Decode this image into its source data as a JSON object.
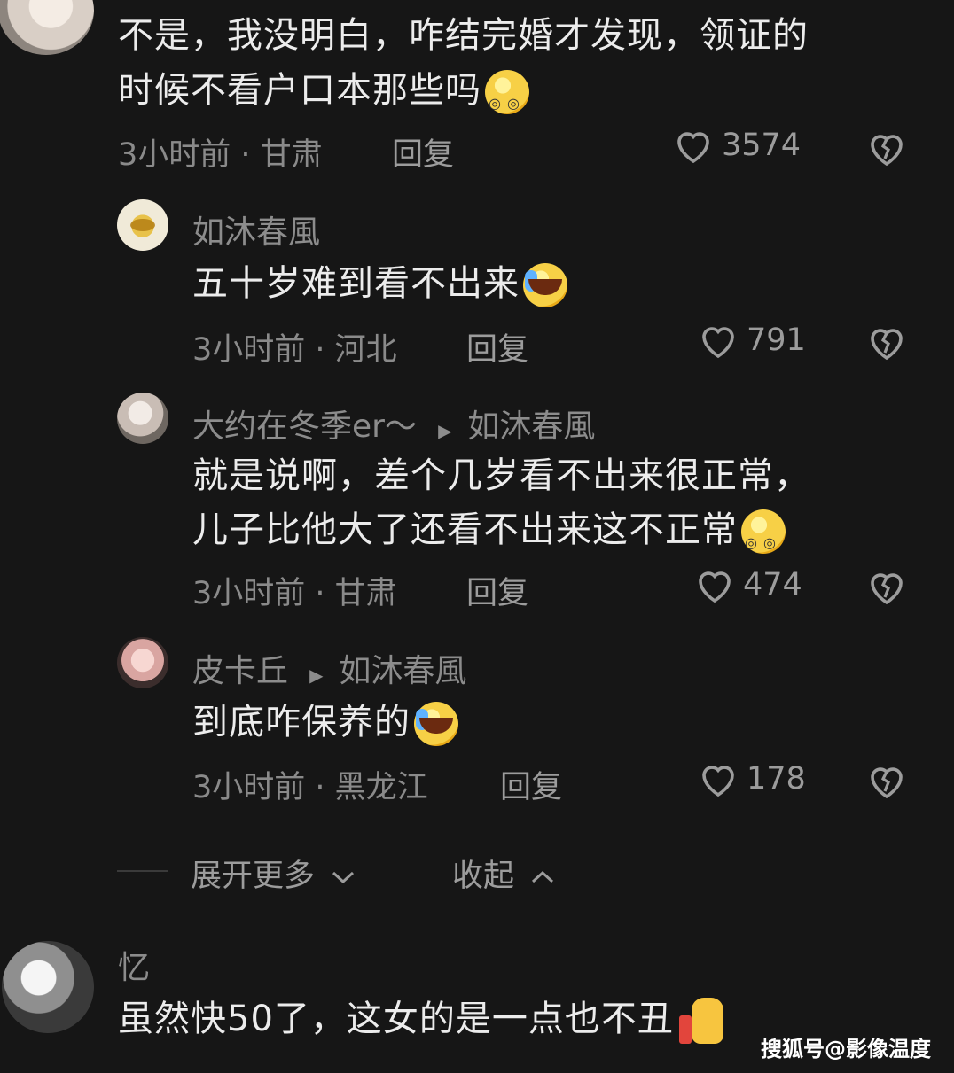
{
  "comment1": {
    "text_line1": "不是，我没明白，咋结完婚才发现，领证的",
    "text_line2": "时候不看户口本那些吗",
    "meta": "3小时前 · 甘肃",
    "reply": "回复",
    "likes": "3574",
    "emoji": "dizzy-face-emoji"
  },
  "reply1": {
    "username": "如沐春風",
    "text": "五十岁难到看不出来",
    "meta": "3小时前 · 河北",
    "reply": "回复",
    "likes": "791",
    "emoji": "laughing-crying-emoji"
  },
  "reply2": {
    "username": "大约在冬季er～",
    "reply_to": "如沐春風",
    "text_line1": "就是说啊，差个几岁看不出来很正常，",
    "text_line2": "儿子比他大了还看不出来这不正常",
    "meta": "3小时前 · 甘肃",
    "reply": "回复",
    "likes": "474",
    "emoji": "dizzy-face-emoji"
  },
  "reply3": {
    "username": "皮卡丘",
    "reply_to": "如沐春風",
    "text": "到底咋保养的",
    "meta": "3小时前 · 黑龙江",
    "reply": "回复",
    "likes": "178",
    "emoji": "laughing-crying-emoji"
  },
  "thread_controls": {
    "expand_label": "展开更多",
    "collapse_label": "收起"
  },
  "comment2": {
    "username": "忆",
    "text": "虽然快50了，这女的是一点也不丑",
    "emoji": "thumbs-up-emoji"
  },
  "watermark": "搜狐号@影像温度",
  "colors": {
    "background": "#161616",
    "text": "#ececec",
    "muted": "#8a8a8a"
  }
}
